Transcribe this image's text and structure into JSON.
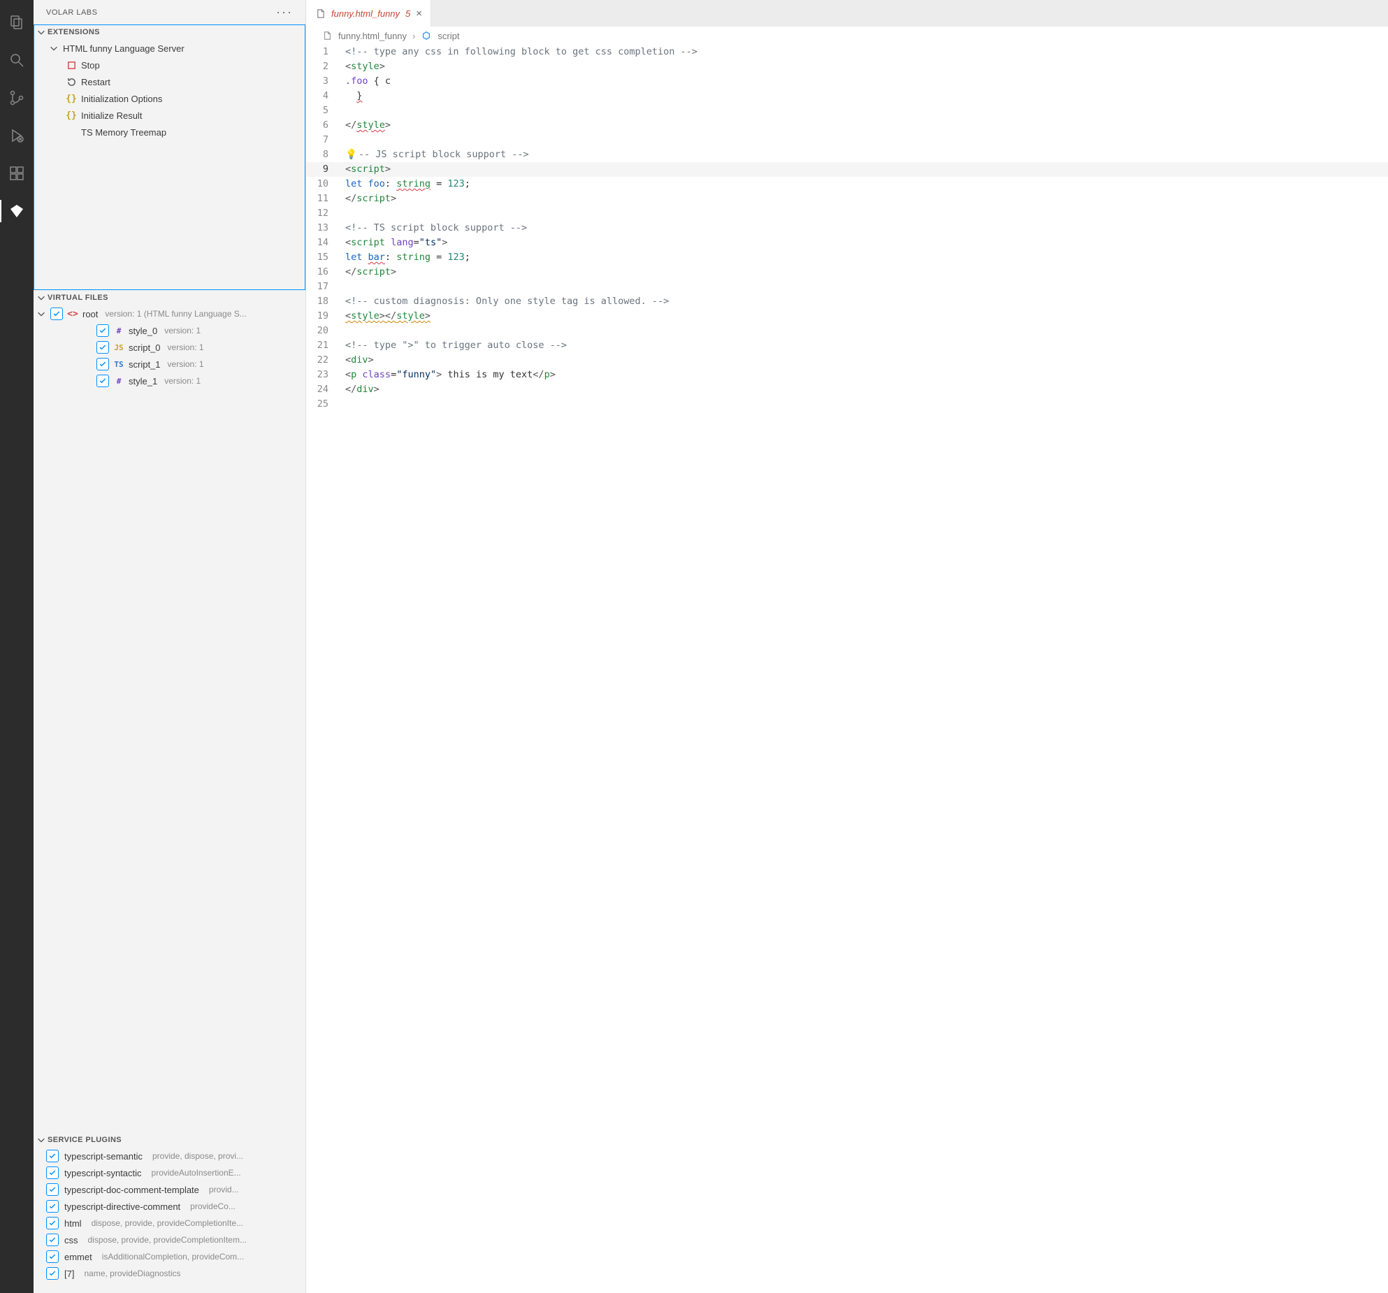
{
  "sidebar": {
    "title": "VOLAR LABS"
  },
  "panels": {
    "extensions": {
      "label": "EXTENSIONS",
      "group": "HTML funny Language Server",
      "items": {
        "stop": "Stop",
        "restart": "Restart",
        "initOptions": "Initialization Options",
        "initResult": "Initialize Result",
        "tsMemory": "TS Memory Treemap"
      }
    },
    "virtualFiles": {
      "label": "VIRTUAL FILES",
      "root": {
        "name": "root",
        "detail": "version: 1 (HTML funny Language S..."
      },
      "children": [
        {
          "badge": "#",
          "name": "style_0",
          "detail": "version: 1"
        },
        {
          "badge": "JS",
          "name": "script_0",
          "detail": "version: 1"
        },
        {
          "badge": "TS",
          "name": "script_1",
          "detail": "version: 1"
        },
        {
          "badge": "#",
          "name": "style_1",
          "detail": "version: 1"
        }
      ]
    },
    "servicePlugins": {
      "label": "SERVICE PLUGINS",
      "items": [
        {
          "name": "typescript-semantic",
          "detail": "provide, dispose, provi..."
        },
        {
          "name": "typescript-syntactic",
          "detail": "provideAutoInsertionE..."
        },
        {
          "name": "typescript-doc-comment-template",
          "detail": "provid..."
        },
        {
          "name": "typescript-directive-comment",
          "detail": "provideCo..."
        },
        {
          "name": "html",
          "detail": "dispose, provide, provideCompletionIte..."
        },
        {
          "name": "css",
          "detail": "dispose, provide, provideCompletionItem..."
        },
        {
          "name": "emmet",
          "detail": "isAdditionalCompletion, provideCom..."
        },
        {
          "name": "[7]",
          "detail": "name, provideDiagnostics"
        }
      ]
    }
  },
  "tab": {
    "name": "funny.html_funny",
    "badge": "5"
  },
  "breadcrumbs": {
    "file": "funny.html_funny",
    "symbol": "script"
  },
  "code": {
    "currentLine": 9,
    "lines": [
      {
        "n": 1,
        "tokens": [
          {
            "c": "tok-comment",
            "t": "<!-- type any css in following block to get css completion -->"
          }
        ]
      },
      {
        "n": 2,
        "tokens": [
          {
            "c": "tok-angle",
            "t": "<"
          },
          {
            "c": "tok-tag",
            "t": "style"
          },
          {
            "c": "tok-angle",
            "t": ">"
          }
        ]
      },
      {
        "n": 3,
        "tokens": [
          {
            "c": "tok-sel",
            "t": ".foo"
          },
          {
            "c": "",
            "t": " { c"
          }
        ]
      },
      {
        "n": 4,
        "tokens": [
          {
            "c": "",
            "t": "  "
          },
          {
            "c": "tok-err",
            "t": "}"
          }
        ]
      },
      {
        "n": 5,
        "tokens": []
      },
      {
        "n": 6,
        "tokens": [
          {
            "c": "tok-angle",
            "t": "</"
          },
          {
            "c": "tok-tag tok-err",
            "t": "style"
          },
          {
            "c": "tok-angle",
            "t": ">"
          }
        ]
      },
      {
        "n": 7,
        "tokens": []
      },
      {
        "n": 8,
        "lightbulb": true,
        "tokens": [
          {
            "c": "tok-comment",
            "t": "-- JS script block support -->"
          }
        ]
      },
      {
        "n": 9,
        "tokens": [
          {
            "c": "tok-angle",
            "t": "<"
          },
          {
            "c": "tok-tag",
            "t": "script"
          },
          {
            "c": "tok-angle",
            "t": ">"
          }
        ]
      },
      {
        "n": 10,
        "tokens": [
          {
            "c": "tok-kw",
            "t": "let"
          },
          {
            "c": "",
            "t": " "
          },
          {
            "c": "tok-var",
            "t": "foo"
          },
          {
            "c": "",
            "t": ": "
          },
          {
            "c": "tok-type tok-err",
            "t": "string"
          },
          {
            "c": "",
            "t": " = "
          },
          {
            "c": "tok-num",
            "t": "123"
          },
          {
            "c": "",
            "t": ";"
          }
        ]
      },
      {
        "n": 11,
        "tokens": [
          {
            "c": "tok-angle",
            "t": "</"
          },
          {
            "c": "tok-tag",
            "t": "script"
          },
          {
            "c": "tok-angle",
            "t": ">"
          }
        ]
      },
      {
        "n": 12,
        "tokens": []
      },
      {
        "n": 13,
        "tokens": [
          {
            "c": "tok-comment",
            "t": "<!-- TS script block support -->"
          }
        ]
      },
      {
        "n": 14,
        "tokens": [
          {
            "c": "tok-angle",
            "t": "<"
          },
          {
            "c": "tok-tag",
            "t": "script"
          },
          {
            "c": "",
            "t": " "
          },
          {
            "c": "tok-attr",
            "t": "lang"
          },
          {
            "c": "",
            "t": "="
          },
          {
            "c": "tok-str",
            "t": "\"ts\""
          },
          {
            "c": "tok-angle",
            "t": ">"
          }
        ]
      },
      {
        "n": 15,
        "tokens": [
          {
            "c": "tok-kw",
            "t": "let"
          },
          {
            "c": "",
            "t": " "
          },
          {
            "c": "tok-var tok-err",
            "t": "bar"
          },
          {
            "c": "",
            "t": ": "
          },
          {
            "c": "tok-type",
            "t": "string"
          },
          {
            "c": "",
            "t": " = "
          },
          {
            "c": "tok-num",
            "t": "123"
          },
          {
            "c": "",
            "t": ";"
          }
        ]
      },
      {
        "n": 16,
        "tokens": [
          {
            "c": "tok-angle",
            "t": "</"
          },
          {
            "c": "tok-tag",
            "t": "script"
          },
          {
            "c": "tok-angle",
            "t": ">"
          }
        ]
      },
      {
        "n": 17,
        "tokens": []
      },
      {
        "n": 18,
        "tokens": [
          {
            "c": "tok-comment",
            "t": "<!-- custom diagnosis: Only one style tag is allowed. -->"
          }
        ]
      },
      {
        "n": 19,
        "tokens": [
          {
            "c": "tok-angle tok-warn",
            "t": "<"
          },
          {
            "c": "tok-tag tok-warn",
            "t": "style"
          },
          {
            "c": "tok-angle tok-warn",
            "t": ">"
          },
          {
            "c": "tok-angle tok-warn",
            "t": "</"
          },
          {
            "c": "tok-tag tok-warn",
            "t": "style"
          },
          {
            "c": "tok-angle tok-warn",
            "t": ">"
          }
        ]
      },
      {
        "n": 20,
        "tokens": []
      },
      {
        "n": 21,
        "tokens": [
          {
            "c": "tok-comment",
            "t": "<!-- type \">\" to trigger auto close -->"
          }
        ]
      },
      {
        "n": 22,
        "tokens": [
          {
            "c": "tok-angle",
            "t": "<"
          },
          {
            "c": "tok-tag",
            "t": "div"
          },
          {
            "c": "tok-angle",
            "t": ">"
          }
        ]
      },
      {
        "n": 23,
        "tokens": [
          {
            "c": "tok-angle",
            "t": "<"
          },
          {
            "c": "tok-tag",
            "t": "p"
          },
          {
            "c": "",
            "t": " "
          },
          {
            "c": "tok-attr",
            "t": "class"
          },
          {
            "c": "",
            "t": "="
          },
          {
            "c": "tok-str",
            "t": "\"funny\""
          },
          {
            "c": "tok-angle",
            "t": ">"
          },
          {
            "c": "",
            "t": " this is my text"
          },
          {
            "c": "tok-angle",
            "t": "</"
          },
          {
            "c": "tok-tag",
            "t": "p"
          },
          {
            "c": "tok-angle",
            "t": ">"
          }
        ]
      },
      {
        "n": 24,
        "tokens": [
          {
            "c": "tok-angle",
            "t": "</"
          },
          {
            "c": "tok-tag",
            "t": "div"
          },
          {
            "c": "tok-angle",
            "t": ">"
          }
        ]
      },
      {
        "n": 25,
        "tokens": []
      }
    ]
  }
}
